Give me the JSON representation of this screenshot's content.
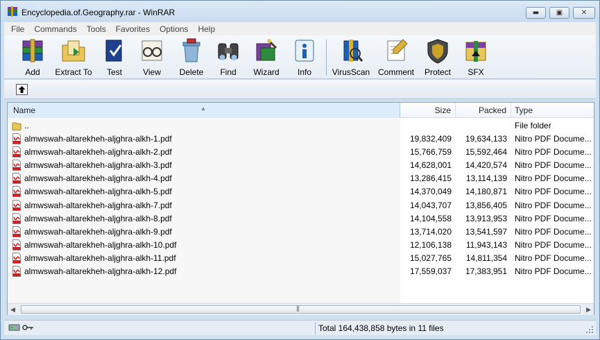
{
  "window": {
    "title": "Encyclopedia.of.Geography.rar - WinRAR",
    "minimize_icon": "minimize-icon",
    "maximize_icon": "maximize-icon",
    "close_icon": "close-icon",
    "minimize_glyph": "▬",
    "maximize_glyph": "▣",
    "close_glyph": "✕"
  },
  "menu": [
    "File",
    "Commands",
    "Tools",
    "Favorites",
    "Options",
    "Help"
  ],
  "toolbar": {
    "tools": [
      {
        "label": "Add",
        "icon": "archive-books-icon"
      },
      {
        "label": "Extract To",
        "icon": "extract-folder-icon"
      },
      {
        "label": "Test",
        "icon": "test-book-icon"
      },
      {
        "label": "View",
        "icon": "view-glasses-icon"
      },
      {
        "label": "Delete",
        "icon": "delete-recycle-icon"
      },
      {
        "label": "Find",
        "icon": "binoculars-icon"
      },
      {
        "label": "Wizard",
        "icon": "wizard-icon"
      },
      {
        "label": "Info",
        "icon": "info-icon"
      },
      {
        "label": "VirusScan",
        "icon": "virus-scan-icon"
      },
      {
        "label": "Comment",
        "icon": "comment-icon"
      },
      {
        "label": "Protect",
        "icon": "protect-shield-icon"
      },
      {
        "label": "SFX",
        "icon": "sfx-icon"
      }
    ]
  },
  "address": {
    "up_icon": "up-folder-icon"
  },
  "filelist": {
    "columns": {
      "name": "Name",
      "size": "Size",
      "packed": "Packed",
      "type": "Type"
    },
    "sort_glyph": "▲",
    "rows": [
      {
        "name": "..",
        "size": "",
        "packed": "",
        "type": "File folder",
        "icon": "folder-icon"
      },
      {
        "name": "almwswah-altarekheh-aljghra-alkh-1.pdf",
        "size": "19,832,409",
        "packed": "19,634,133",
        "type": "Nitro PDF Docume...",
        "icon": "pdf-icon"
      },
      {
        "name": "almwswah-altarekheh-aljghra-alkh-2.pdf",
        "size": "15,766,759",
        "packed": "15,592,464",
        "type": "Nitro PDF Docume...",
        "icon": "pdf-icon"
      },
      {
        "name": "almwswah-altarekheh-aljghra-alkh-3.pdf",
        "size": "14,628,001",
        "packed": "14,420,574",
        "type": "Nitro PDF Docume...",
        "icon": "pdf-icon"
      },
      {
        "name": "almwswah-altarekheh-aljghra-alkh-4.pdf",
        "size": "13,286,415",
        "packed": "13,114,139",
        "type": "Nitro PDF Docume...",
        "icon": "pdf-icon"
      },
      {
        "name": "almwswah-altarekheh-aljghra-alkh-5.pdf",
        "size": "14,370,049",
        "packed": "14,180,871",
        "type": "Nitro PDF Docume...",
        "icon": "pdf-icon"
      },
      {
        "name": "almwswah-altarekheh-aljghra-alkh-7.pdf",
        "size": "14,043,707",
        "packed": "13,856,405",
        "type": "Nitro PDF Docume...",
        "icon": "pdf-icon"
      },
      {
        "name": "almwswah-altarekheh-aljghra-alkh-8.pdf",
        "size": "14,104,558",
        "packed": "13,913,953",
        "type": "Nitro PDF Docume...",
        "icon": "pdf-icon"
      },
      {
        "name": "almwswah-altarekheh-aljghra-alkh-9.pdf",
        "size": "13,714,020",
        "packed": "13,541,597",
        "type": "Nitro PDF Docume...",
        "icon": "pdf-icon"
      },
      {
        "name": "almwswah-altarekheh-aljghra-alkh-10.pdf",
        "size": "12,106,138",
        "packed": "11,943,143",
        "type": "Nitro PDF Docume...",
        "icon": "pdf-icon"
      },
      {
        "name": "almwswah-altarekheh-aljghra-alkh-11.pdf",
        "size": "15,027,765",
        "packed": "14,811,354",
        "type": "Nitro PDF Docume...",
        "icon": "pdf-icon"
      },
      {
        "name": "almwswah-altarekheh-aljghra-alkh-12.pdf",
        "size": "17,559,037",
        "packed": "17,383,951",
        "type": "Nitro PDF Docume...",
        "icon": "pdf-icon"
      }
    ]
  },
  "hscroll": {
    "left_glyph": "◀",
    "right_glyph": "▶",
    "grip_glyph": "|||"
  },
  "status": {
    "text": "Total 164,438,858 bytes in 11 files",
    "drive_icon": "drive-icon",
    "key_icon": "key-icon"
  },
  "colors": {
    "title_bg": "#c9dcef",
    "menu_bg": "#f0f0f0",
    "header_sort_bg": "#dcecfb",
    "pdf_red": "#cc1f1f",
    "folder_yellow": "#e8c65a"
  }
}
